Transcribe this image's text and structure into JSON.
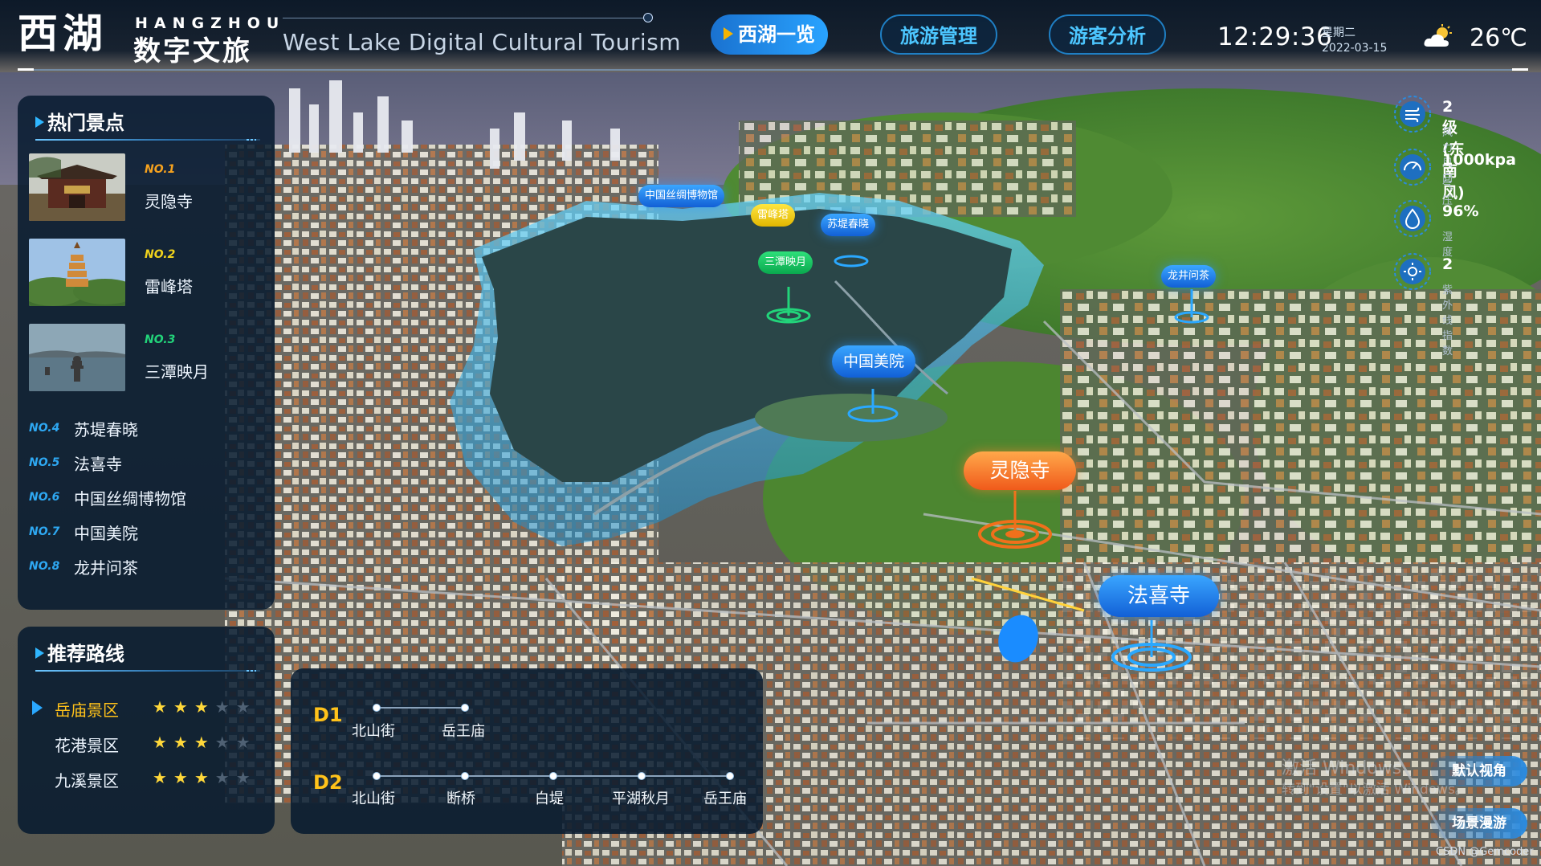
{
  "header": {
    "logo_cn": "西湖",
    "logo_en": "HANGZHOU",
    "logo_sub": "数字文旅",
    "title": "West Lake Digital Cultural Tourism",
    "nav": [
      {
        "label": "西湖一览",
        "active": true
      },
      {
        "label": "旅游管理",
        "active": false
      },
      {
        "label": "游客分析",
        "active": false
      }
    ],
    "time": "12:29:36",
    "weekday": "星期二",
    "date": "2022-03-15",
    "weather_icon": "partly-cloudy-icon",
    "temperature": "26℃"
  },
  "hot_spots": {
    "title": "热门景点",
    "featured": [
      {
        "no": "NO.1",
        "name": "灵隐寺",
        "no_color": "#f6a21e"
      },
      {
        "no": "NO.2",
        "name": "雷峰塔",
        "no_color": "#f0d21c"
      },
      {
        "no": "NO.3",
        "name": "三潭映月",
        "no_color": "#22d47a"
      }
    ],
    "list": [
      {
        "no": "NO.4",
        "name": "苏堤春晓"
      },
      {
        "no": "NO.5",
        "name": "法喜寺"
      },
      {
        "no": "NO.6",
        "name": "中国丝绸博物馆"
      },
      {
        "no": "NO.7",
        "name": "中国美院"
      },
      {
        "no": "NO.8",
        "name": "龙井问茶"
      }
    ]
  },
  "routes": {
    "title": "推荐路线",
    "items": [
      {
        "name": "岳庙景区",
        "stars": 3,
        "max": 5,
        "selected": true,
        "color": "#ffc21a"
      },
      {
        "name": "花港景区",
        "stars": 3,
        "max": 5,
        "selected": false,
        "color": "#eef6ff"
      },
      {
        "name": "九溪景区",
        "stars": 3,
        "max": 5,
        "selected": false,
        "color": "#eef6ff"
      }
    ]
  },
  "itinerary": [
    {
      "day": "D1",
      "stops": [
        "北山街",
        "岳王庙"
      ]
    },
    {
      "day": "D2",
      "stops": [
        "北山街",
        "断桥",
        "白堤",
        "平湖秋月",
        "岳王庙"
      ]
    }
  ],
  "environment": [
    {
      "value": "2级(东南风)",
      "label": "风力风向",
      "icon": "wind-icon"
    },
    {
      "value": "1000kpa",
      "label": "气压",
      "icon": "gauge-icon"
    },
    {
      "value": "96%",
      "label": "湿度",
      "icon": "humidity-icon"
    },
    {
      "value": "2",
      "label": "紫外线指数",
      "icon": "sun-uv-icon"
    }
  ],
  "map_markers": [
    {
      "label": "中国丝绸博物馆",
      "style": "blue small"
    },
    {
      "label": "雷峰塔",
      "style": "yellow small"
    },
    {
      "label": "苏堤春晓",
      "style": "blue small"
    },
    {
      "label": "三潭映月",
      "style": "green small"
    },
    {
      "label": "龙井问茶",
      "style": "blue small"
    },
    {
      "label": "中国美院",
      "style": "blue mid"
    },
    {
      "label": "灵隐寺",
      "style": "orange mid"
    },
    {
      "label": "法喜寺",
      "style": "blue big"
    }
  ],
  "view_controls": {
    "default_view": "默认视角",
    "scene_roam": "场景漫游"
  },
  "watermark": {
    "line1": "激活 Windows",
    "line2": "转到\"设置\"以激活 Windows。"
  },
  "credit": "CSDN @Gemcoder",
  "colors": {
    "accent_blue": "#2aa8ff",
    "accent_gold": "#ffc21a",
    "marker_orange": "#f0701b",
    "panel_bg": "#061a2e"
  }
}
